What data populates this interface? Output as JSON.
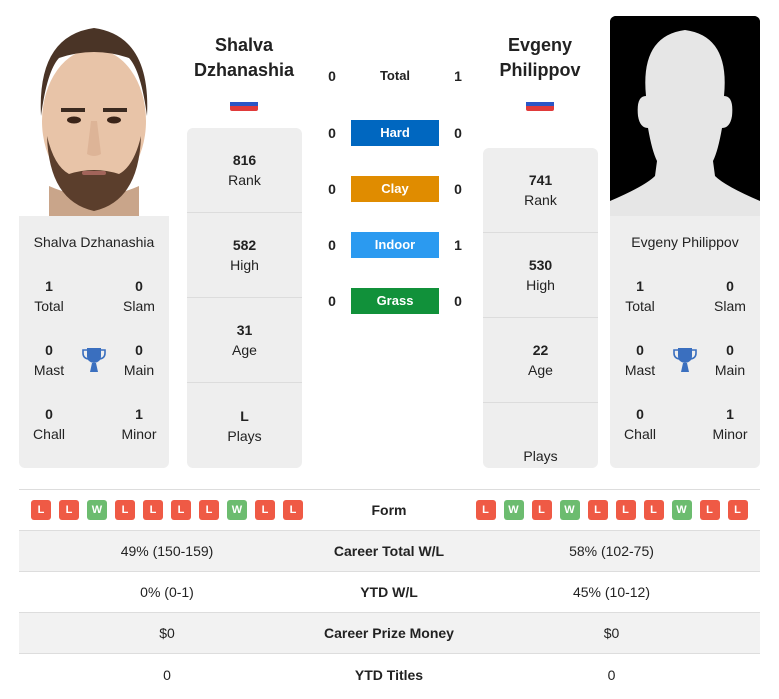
{
  "players": {
    "left": {
      "name_line1": "Shalva",
      "name_line2": "Dzhanashia",
      "full_name": "Shalva Dzhanashia",
      "flag": "russia-flag",
      "rank": {
        "value": "816",
        "label": "Rank"
      },
      "high": {
        "value": "582",
        "label": "High"
      },
      "age": {
        "value": "31",
        "label": "Age"
      },
      "plays": {
        "value": "L",
        "label": "Plays"
      },
      "titles": {
        "total": {
          "value": "1",
          "label": "Total"
        },
        "slam": {
          "value": "0",
          "label": "Slam"
        },
        "mast": {
          "value": "0",
          "label": "Mast"
        },
        "main": {
          "value": "0",
          "label": "Main"
        },
        "chall": {
          "value": "0",
          "label": "Chall"
        },
        "minor": {
          "value": "1",
          "label": "Minor"
        }
      },
      "form": [
        "L",
        "L",
        "W",
        "L",
        "L",
        "L",
        "L",
        "W",
        "L",
        "L"
      ]
    },
    "right": {
      "name_line1": "Evgeny",
      "name_line2": "Philippov",
      "full_name": "Evgeny Philippov",
      "flag": "russia-flag",
      "rank": {
        "value": "741",
        "label": "Rank"
      },
      "high": {
        "value": "530",
        "label": "High"
      },
      "age": {
        "value": "22",
        "label": "Age"
      },
      "plays": {
        "value": "",
        "label": "Plays"
      },
      "titles": {
        "total": {
          "value": "1",
          "label": "Total"
        },
        "slam": {
          "value": "0",
          "label": "Slam"
        },
        "mast": {
          "value": "0",
          "label": "Mast"
        },
        "main": {
          "value": "0",
          "label": "Main"
        },
        "chall": {
          "value": "0",
          "label": "Chall"
        },
        "minor": {
          "value": "1",
          "label": "Minor"
        }
      },
      "form": [
        "L",
        "W",
        "L",
        "W",
        "L",
        "L",
        "L",
        "W",
        "L",
        "L"
      ]
    }
  },
  "h2h": [
    {
      "label": "Total",
      "left": "0",
      "right": "1",
      "color": ""
    },
    {
      "label": "Hard",
      "left": "0",
      "right": "0",
      "color": "#0067c0"
    },
    {
      "label": "Clay",
      "left": "0",
      "right": "0",
      "color": "#e08c00"
    },
    {
      "label": "Indoor",
      "left": "0",
      "right": "1",
      "color": "#2b9af0"
    },
    {
      "label": "Grass",
      "left": "0",
      "right": "0",
      "color": "#11913a"
    }
  ],
  "stats": {
    "form_label": "Form",
    "rows": [
      {
        "left": "49% (150-159)",
        "label": "Career Total W/L",
        "right": "58% (102-75)"
      },
      {
        "left": "0% (0-1)",
        "label": "YTD W/L",
        "right": "45% (10-12)"
      },
      {
        "left": "$0",
        "label": "Career Prize Money",
        "right": "$0"
      },
      {
        "left": "0",
        "label": "YTD Titles",
        "right": "0"
      }
    ]
  },
  "colors": {
    "loss": "#ef5a45",
    "win": "#6cbc6f",
    "trophy": "#3a6fbf",
    "card_bg": "#eeeeee"
  }
}
